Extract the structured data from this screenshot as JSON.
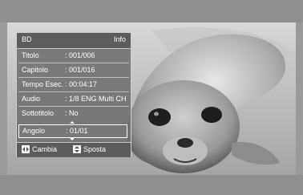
{
  "panel": {
    "title": "BD",
    "info_label": "Info",
    "rows": [
      {
        "label": "Titolo",
        "value": ": 001/006"
      },
      {
        "label": "Capitolo",
        "value": ": 001/016"
      },
      {
        "label": "Tempo Esec.",
        "value": ": 00:04:17"
      },
      {
        "label": "Audio",
        "value": ": 1/8 ENG Multi CH"
      },
      {
        "label": "Sottotitolo",
        "value": ": No"
      },
      {
        "label": "Angolo",
        "value": ": 01/01"
      }
    ],
    "selected_row": "Angolo",
    "footer": {
      "change_hint": "Cambia",
      "change_icon": "left-right-arrows-icon",
      "move_hint": "Sposta",
      "move_icon": "up-down-arrows-icon"
    }
  }
}
